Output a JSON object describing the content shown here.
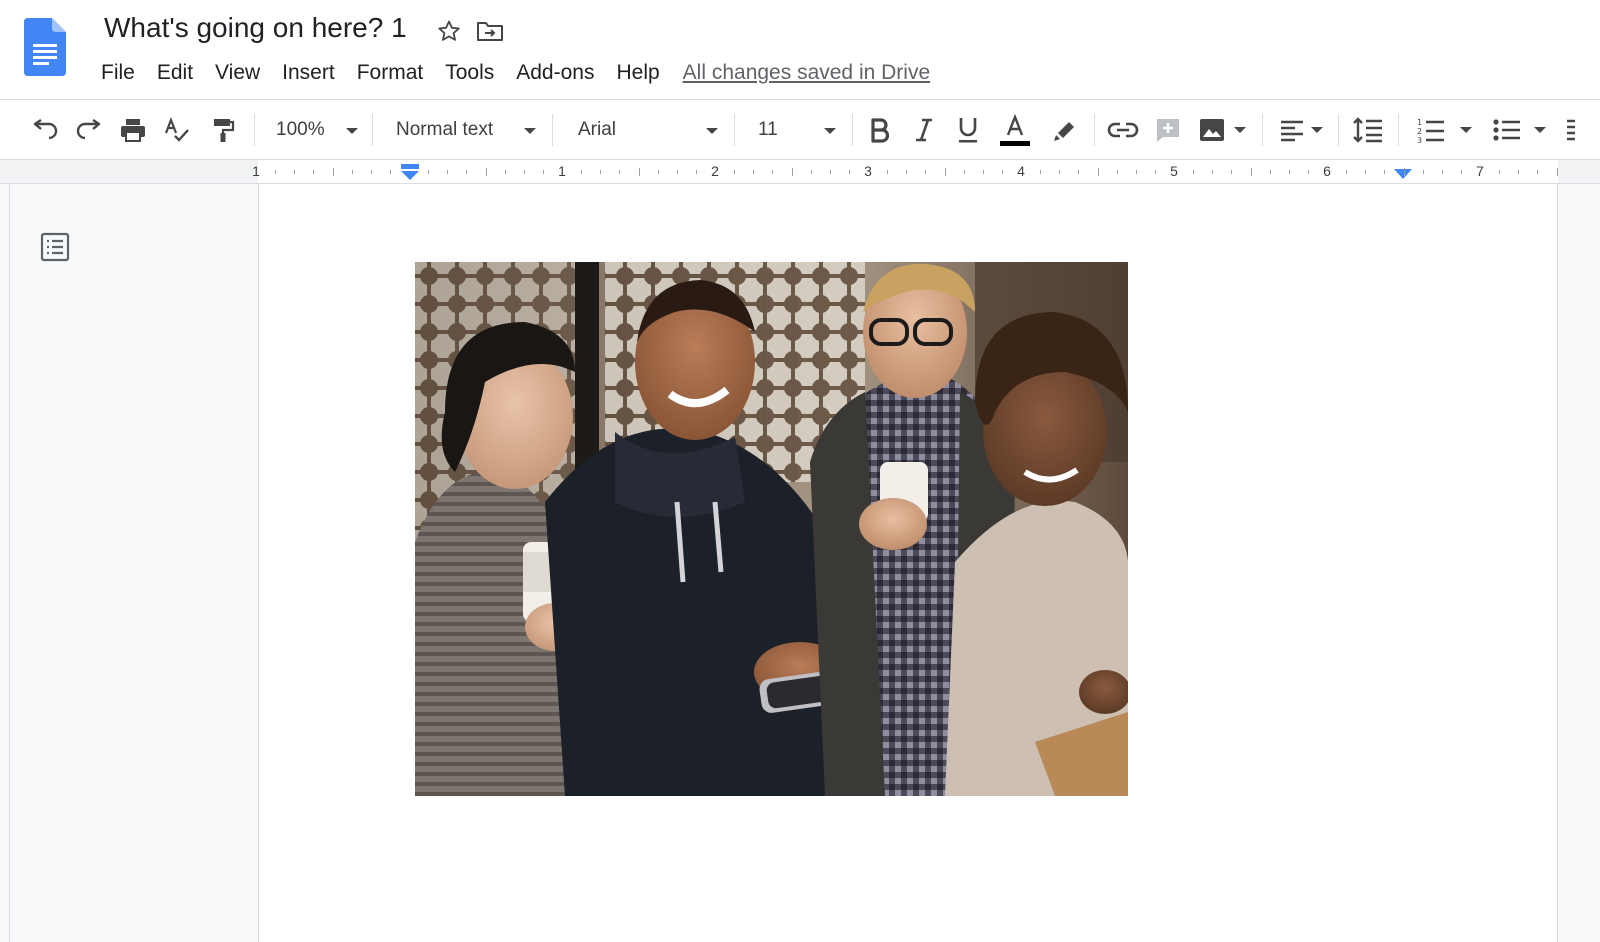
{
  "doc": {
    "title": "What's going on here? 1",
    "save_status": "All changes saved in Drive"
  },
  "menu": [
    "File",
    "Edit",
    "View",
    "Insert",
    "Format",
    "Tools",
    "Add-ons",
    "Help"
  ],
  "toolbar": {
    "zoom": "100%",
    "style": "Normal text",
    "font": "Arial",
    "size": "11"
  },
  "ruler": {
    "labels": [
      "1",
      "1",
      "2",
      "3",
      "4",
      "5",
      "6",
      "7"
    ]
  },
  "colors": {
    "brand_blue": "#4285f4",
    "text_color_bar": "#000000",
    "indent_marker": "#4285f4"
  },
  "image": {
    "description_hidden": ""
  }
}
